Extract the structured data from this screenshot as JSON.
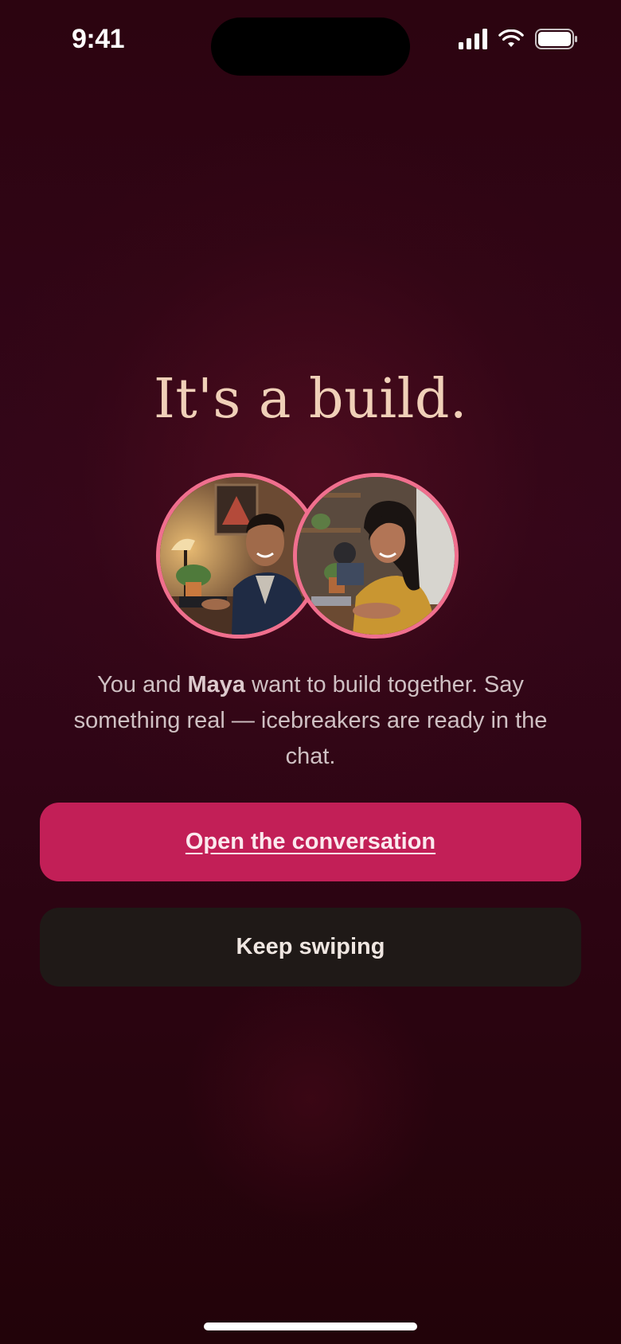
{
  "status_bar": {
    "time": "9:41",
    "signal_icon": "cellular-signal-icon",
    "wifi_icon": "wifi-icon",
    "battery_icon": "battery-icon"
  },
  "match": {
    "title": "It's a build.",
    "message_prefix": "You and ",
    "match_name": "Maya",
    "message_suffix": " want to build together. Say something real — icebreakers are ready in the chat."
  },
  "avatars": {
    "user_photo": "user-avatar-photo",
    "match_photo": "match-avatar-photo"
  },
  "actions": {
    "primary_label": "Open the conversation",
    "secondary_label": "Keep swiping"
  },
  "colors": {
    "background": "#2b0510",
    "title": "#f0d0b8",
    "accent_pink": "#c21f57",
    "avatar_ring": "#f06f8e",
    "secondary_button": "#1f1917"
  }
}
